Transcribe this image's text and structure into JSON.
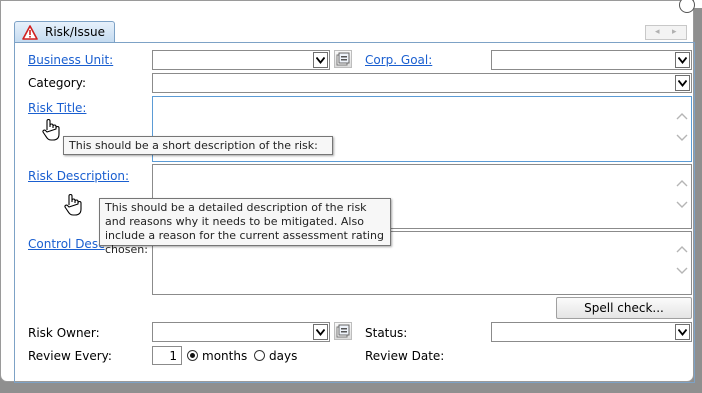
{
  "tab": {
    "label": "Risk/Issue",
    "icon": "warning-icon"
  },
  "labels": {
    "business_unit": "Business Unit:",
    "corp_goal": "Corp. Goal:",
    "category": "Category:",
    "risk_title": "Risk Title:",
    "risk_description": "Risk Description:",
    "control_description": "Control Desc",
    "risk_owner": "Risk Owner:",
    "status": "Status:",
    "review_every": "Review Every:",
    "review_date": "Review Date:"
  },
  "fields": {
    "business_unit": "",
    "corp_goal": "",
    "category": "",
    "risk_title": "",
    "risk_description": "",
    "control_description": "",
    "risk_owner": "",
    "status": "",
    "review_every": "1"
  },
  "review_units": {
    "months": "months",
    "days": "days",
    "selected": "months"
  },
  "buttons": {
    "spell_check": "Spell check..."
  },
  "tooltips": {
    "risk_title": "This should be a short description of the risk:",
    "risk_description": "This should be a detailed description of the risk and reasons why it needs to be mitigated. Also include a reason for the current assessment rating chosen:"
  },
  "colors": {
    "link": "#1a5fd0",
    "focus_border": "#5b9bd5",
    "tab_border": "#7da2c6"
  }
}
